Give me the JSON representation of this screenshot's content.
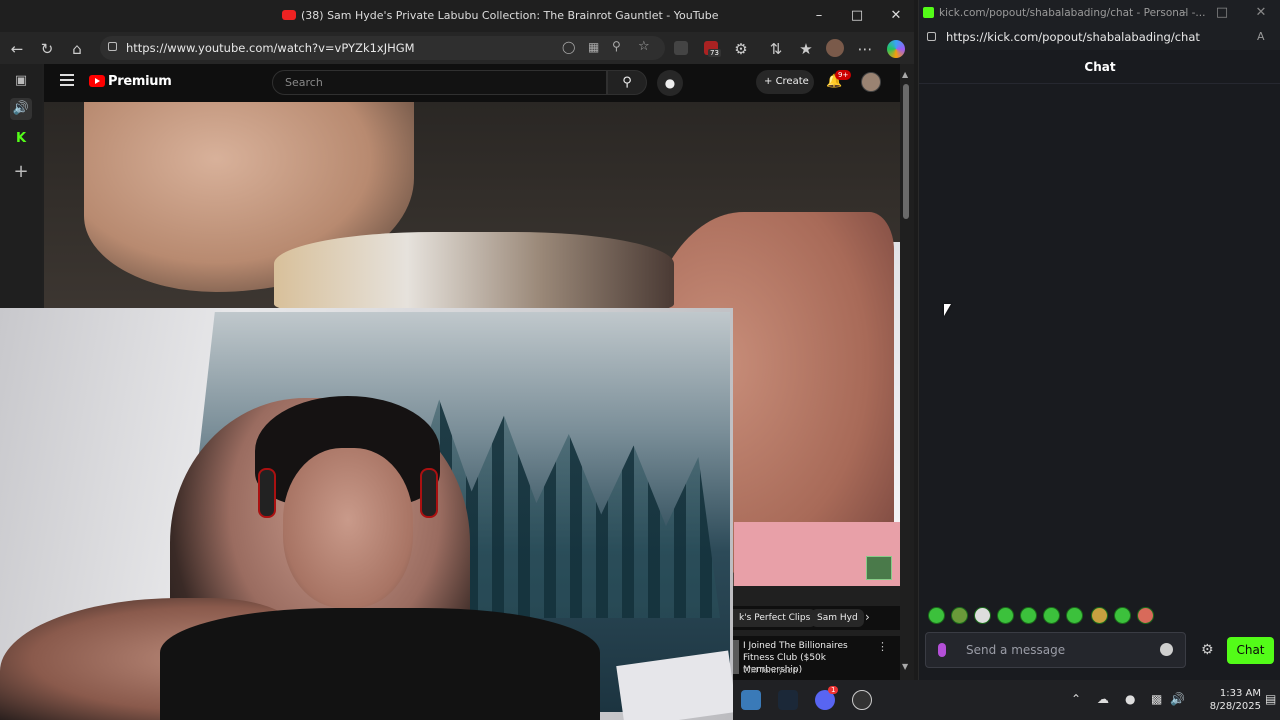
{
  "youtube_window": {
    "title": "(38) Sam Hyde's Private Labubu Collection: The Brainrot Gauntlet - YouTube",
    "url": "https://www.youtube.com/watch?v=vPYZk1xJHGM",
    "extension_badge": "73",
    "header": {
      "brand": "Premium",
      "search_placeholder": "Search",
      "create_label": "Create",
      "notifications_badge": "9+"
    },
    "chips": [
      "k's Perfect Clips",
      "Sam Hyd"
    ],
    "recommendation": {
      "title": "I Joined The Billionaires Fitness Club ($50k Membership)",
      "channel": "Will Tennyson"
    }
  },
  "kick_window": {
    "title": "kick.com/popout/shabalabading/chat - Personal -...",
    "url": "https://kick.com/popout/shabalabading/chat",
    "chat_header": "Chat",
    "input_placeholder": "Send a message",
    "send_label": "Chat",
    "accent_color": "#53fc18"
  },
  "taskbar": {
    "time": "1:33 AM",
    "date": "8/28/2025",
    "discord_badge": "1"
  },
  "icons": [
    "back-icon",
    "refresh-icon",
    "home-icon",
    "lock-icon",
    "star-icon",
    "more-icon",
    "search-icon",
    "mic-icon",
    "bell-icon",
    "chevron-right-icon",
    "gear-icon",
    "emoji-icon"
  ]
}
